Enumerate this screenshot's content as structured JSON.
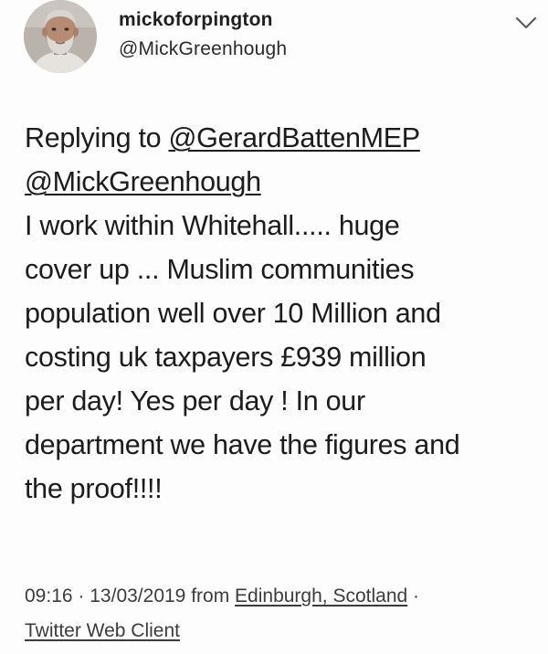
{
  "user": {
    "display_name": "mickoforpington",
    "handle": "@MickGreenhough"
  },
  "icons": {
    "menu": "chevron-down-icon",
    "avatar": "avatar"
  },
  "reply": {
    "prefix": "Replying to",
    "mentions": [
      "@GerardBattenMEP",
      "@MickGreenhough"
    ]
  },
  "body_lines": [
    "I work within Whitehall..... huge",
    "cover up ... Muslim communities",
    "population well over 10 Million and",
    "costing uk taxpayers £939 million",
    "per day! Yes per day ! In our",
    "department we have the figures and",
    "the proof!!!!"
  ],
  "meta": {
    "time": "09:16",
    "separator": "·",
    "date": "13/03/2019",
    "from": "from",
    "location": "Edinburgh, Scotland",
    "source": "Twitter Web Client"
  }
}
